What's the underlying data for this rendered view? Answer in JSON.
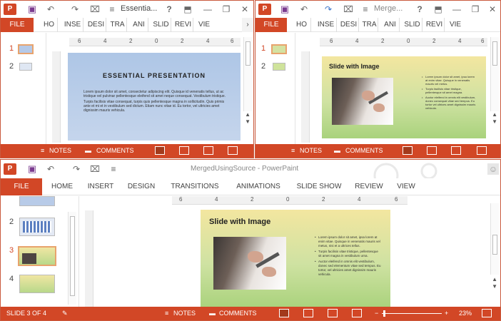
{
  "windows": {
    "left": {
      "title": "Essentia...",
      "tabs": [
        "FILE",
        "HO",
        "INSE",
        "DESI",
        "TRA",
        "ANI",
        "SLID",
        "REVI",
        "VIE"
      ],
      "ruler_labels": [
        "6",
        "4",
        "2",
        "0",
        "2",
        "4",
        "6"
      ],
      "thumbnail_numbers": [
        "1",
        "2"
      ],
      "slide": {
        "title": "ESSENTIAL PRESENTATION",
        "body": [
          "Lorem ipsum dolor sit amet, consectetur adipiscing elit. Quisque id venenatis tellus, ut ac tristique vel pulvinar pellentesque eleifend sit amet neque consequat. Vestibulum tristique.",
          "Turpis facilisis vitae consequat, turpis quis pellentesque magna in sollicitudin. Quis primis ante et mi et in vestibulum sed dictum. Etiam nunc vitae id. Eu tortor, vel ultricies amet dignissim mauris vehicula."
        ]
      },
      "status": {
        "notes": "NOTES",
        "comments": "COMMENTS"
      }
    },
    "right": {
      "title": "Merge...",
      "tabs": [
        "FILE",
        "HO",
        "INSE",
        "DESI",
        "TRA",
        "ANI",
        "SLID",
        "REVI",
        "VIE"
      ],
      "ruler_labels": [
        "6",
        "4",
        "2",
        "0",
        "2",
        "4",
        "6"
      ],
      "thumbnail_numbers": [
        "1",
        "2"
      ],
      "slide": {
        "title": "Slide with Image",
        "bullets": [
          "Lorem ipsum dolor sit amet, ipsa lorem at enim vitae. Quisque in venenatis mauris vel metus.",
          "Turpis facilisis vitae tristique, pellentesque sit amet magna.",
          "Auctor eleifend in omnis elit vestibulum, donec consequat vitae sed tempus. Eu tortor vel ultrices amet dignissim mauris vehicula."
        ]
      },
      "status": {
        "notes": "NOTES",
        "comments": "COMMENTS"
      }
    },
    "main": {
      "title": "MergedUsingSource - PowerPaint",
      "tabs": [
        "FILE",
        "HOME",
        "INSERT",
        "DESIGN",
        "TRANSITIONS",
        "ANIMATIONS",
        "SLIDE SHOW",
        "REVIEW",
        "VIEW"
      ],
      "ruler_labels": [
        "6",
        "4",
        "2",
        "0",
        "2",
        "4",
        "6"
      ],
      "thumbnail_numbers": [
        "2",
        "3",
        "4"
      ],
      "slide": {
        "title": "Slide with Image",
        "bullets": [
          "Lorem ipsum dolor sit amet, ipsa lorem at enim vitae. Quisque in venenatis mauris vel metus, nisi et a ultrices tellus.",
          "Turpis facilisis vitae tristique, pellentesque sit amet magna in vestibulum urna.",
          "Auctor eleifend in omnis elit vestibulum, donec sed elementum vitae sed tempus. Eu tortor, vel ultricies amet dignissim mauris vehicula."
        ]
      },
      "status": {
        "slide_info": "SLIDE 3 OF 4",
        "notes": "NOTES",
        "comments": "COMMENTS",
        "zoom": "23%"
      }
    }
  },
  "icons": {
    "undo": "↶",
    "redo": "↷",
    "help": "?",
    "minimize": "—",
    "close": "✕",
    "restore": "❐"
  },
  "colors": {
    "accent": "#d24726",
    "brand_border": "#c95a3d"
  }
}
